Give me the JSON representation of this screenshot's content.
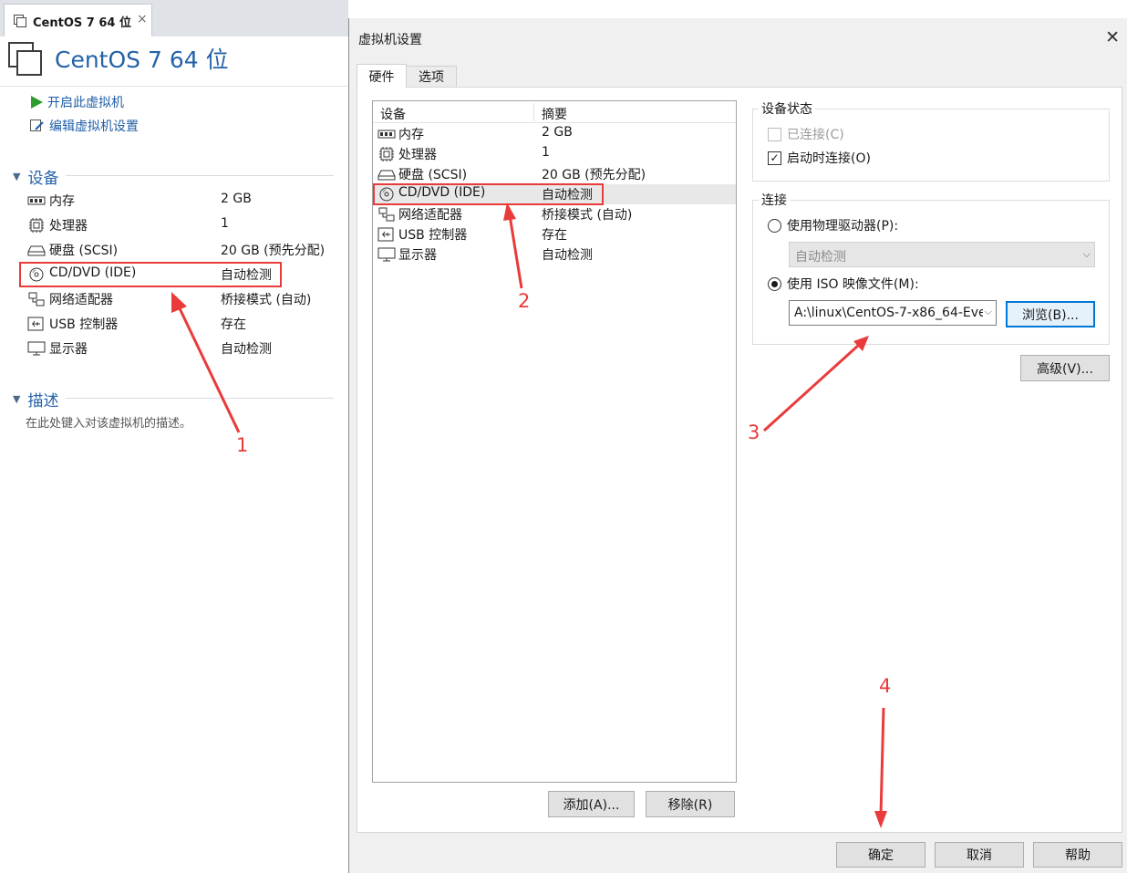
{
  "vm_tab": {
    "label": "CentOS 7 64 位",
    "close": "×"
  },
  "vm_title": "CentOS 7 64 位",
  "actions": {
    "power_on": "开启此虚拟机",
    "edit_settings": "编辑虚拟机设置"
  },
  "left_sections": {
    "devices": "设备",
    "description": "描述"
  },
  "description_placeholder": "在此处键入对该虚拟机的描述。",
  "devices": [
    {
      "icon": "memory-icon",
      "name": "内存",
      "value": "2 GB"
    },
    {
      "icon": "processor-icon",
      "name": "处理器",
      "value": "1"
    },
    {
      "icon": "hard-disk-icon",
      "name": "硬盘 (SCSI)",
      "value": "20 GB (预先分配)"
    },
    {
      "icon": "cd-dvd-icon",
      "name": "CD/DVD (IDE)",
      "value": "自动检测"
    },
    {
      "icon": "network-adapter-icon",
      "name": "网络适配器",
      "value": "桥接模式 (自动)"
    },
    {
      "icon": "usb-controller-icon",
      "name": "USB 控制器",
      "value": "存在"
    },
    {
      "icon": "display-icon",
      "name": "显示器",
      "value": "自动检测"
    }
  ],
  "dialog": {
    "title": "虚拟机设置",
    "close": "✕",
    "tabs": [
      "硬件",
      "选项"
    ],
    "list_headers": {
      "device": "设备",
      "summary": "摘要"
    },
    "hardware": [
      {
        "icon": "memory-icon",
        "name": "内存",
        "summary": "2 GB"
      },
      {
        "icon": "processor-icon",
        "name": "处理器",
        "summary": "1"
      },
      {
        "icon": "hard-disk-icon",
        "name": "硬盘 (SCSI)",
        "summary": "20 GB (预先分配)"
      },
      {
        "icon": "cd-dvd-icon",
        "name": "CD/DVD (IDE)",
        "summary": "自动检测",
        "selected": true
      },
      {
        "icon": "network-adapter-icon",
        "name": "网络适配器",
        "summary": "桥接模式 (自动)"
      },
      {
        "icon": "usb-controller-icon",
        "name": "USB 控制器",
        "summary": "存在"
      },
      {
        "icon": "display-icon",
        "name": "显示器",
        "summary": "自动检测"
      }
    ],
    "add_button": "添加(A)...",
    "remove_button": "移除(R)",
    "device_status": {
      "title": "设备状态",
      "connected": {
        "label": "已连接(C)",
        "checked": false,
        "enabled": false
      },
      "connect_at_power_on": {
        "label": "启动时连接(O)",
        "checked": true,
        "enabled": true
      }
    },
    "connection": {
      "title": "连接",
      "physical_drive": {
        "label": "使用物理驱动器(P):",
        "selected": false,
        "value": "自动检测"
      },
      "iso_image": {
        "label": "使用 ISO 映像文件(M):",
        "selected": true,
        "value": "A:\\linux\\CentOS-7-x86_64-Eve"
      },
      "browse_button": "浏览(B)..."
    },
    "advanced_button": "高级(V)...",
    "ok_button": "确定",
    "cancel_button": "取消",
    "help_button": "帮助"
  },
  "annotations": [
    "1",
    "2",
    "3",
    "4"
  ],
  "colors": {
    "title_blue": "#2462a8",
    "link_blue": "#1f5ea8",
    "annotation_red": "#ea3b3b",
    "focus_blue": "#0078d7",
    "play_green": "#2e9c2e"
  }
}
